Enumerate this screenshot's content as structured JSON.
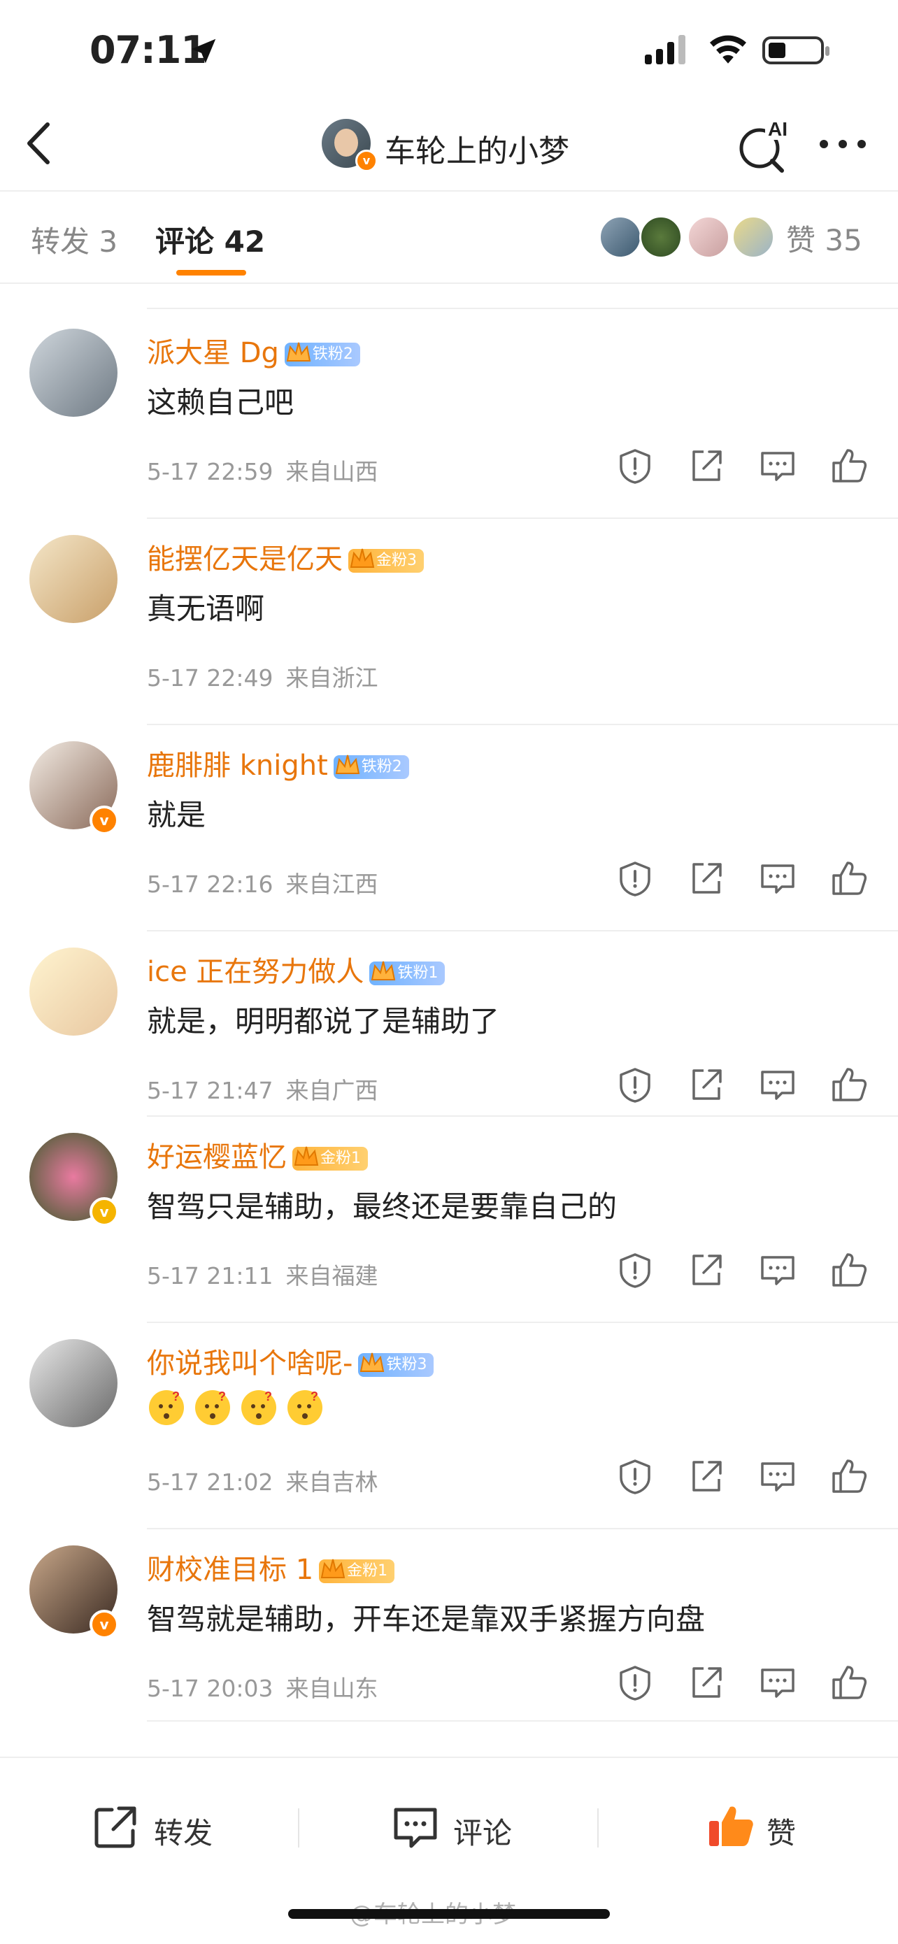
{
  "status_bar": {
    "time": "07:11",
    "icons": [
      "location-arrow-icon",
      "signal-icon",
      "wifi-icon",
      "battery-icon"
    ]
  },
  "nav": {
    "title": "车轮上的小梦",
    "ai_label": "AI",
    "verified_badge": "v"
  },
  "tabs": {
    "repost": "转发 3",
    "comments": "评论 42",
    "likes": "赞 35"
  },
  "colors": {
    "accent": "#ff8200",
    "name": "#e8760c",
    "meta": "#999999"
  },
  "comments": [
    {
      "name": "派大星 Dg",
      "fan_badge": "铁粉2",
      "badge_type": "iron",
      "text": "这赖自己吧",
      "time": "5-17 22:59",
      "location": "来自山西",
      "avatar_verified": false
    },
    {
      "name": "能摆亿天是亿天",
      "fan_badge": "金粉3",
      "badge_type": "gold",
      "text": "真无语啊",
      "time": "5-17 22:49",
      "location": "来自浙江",
      "avatar_verified": false
    },
    {
      "name": "鹿腓腓 knight",
      "fan_badge": "铁粉2",
      "badge_type": "iron",
      "text": "就是",
      "time": "5-17 22:16",
      "location": "来自江西",
      "avatar_verified": true
    },
    {
      "name": "ice 正在努力做人",
      "fan_badge": "铁粉1",
      "badge_type": "iron",
      "text": "就是，明明都说了是辅助了",
      "time": "5-17 21:47",
      "location": "来自广西",
      "avatar_verified": false
    },
    {
      "name": "好运樱蓝忆",
      "fan_badge": "金粉1",
      "badge_type": "gold",
      "text": "智驾只是辅助，最终还是要靠自己的",
      "time": "5-17 21:11",
      "location": "来自福建",
      "avatar_verified": true
    },
    {
      "name": "你说我叫个啥呢-",
      "fan_badge": "铁粉3",
      "badge_type": "iron",
      "text": "",
      "time": "5-17 21:02",
      "location": "来自吉林",
      "avatar_verified": false
    },
    {
      "name": "财校准目标 1",
      "fan_badge": "金粉1",
      "badge_type": "gold",
      "text": "智驾就是辅助，开车还是靠双手紧握方向盘",
      "time": "5-17 20:03",
      "location": "来自山东",
      "avatar_verified": true
    }
  ],
  "bottom_bar": {
    "repost": "转发",
    "comment": "评论",
    "like": "赞"
  },
  "watermark": "@车轮上的小梦"
}
